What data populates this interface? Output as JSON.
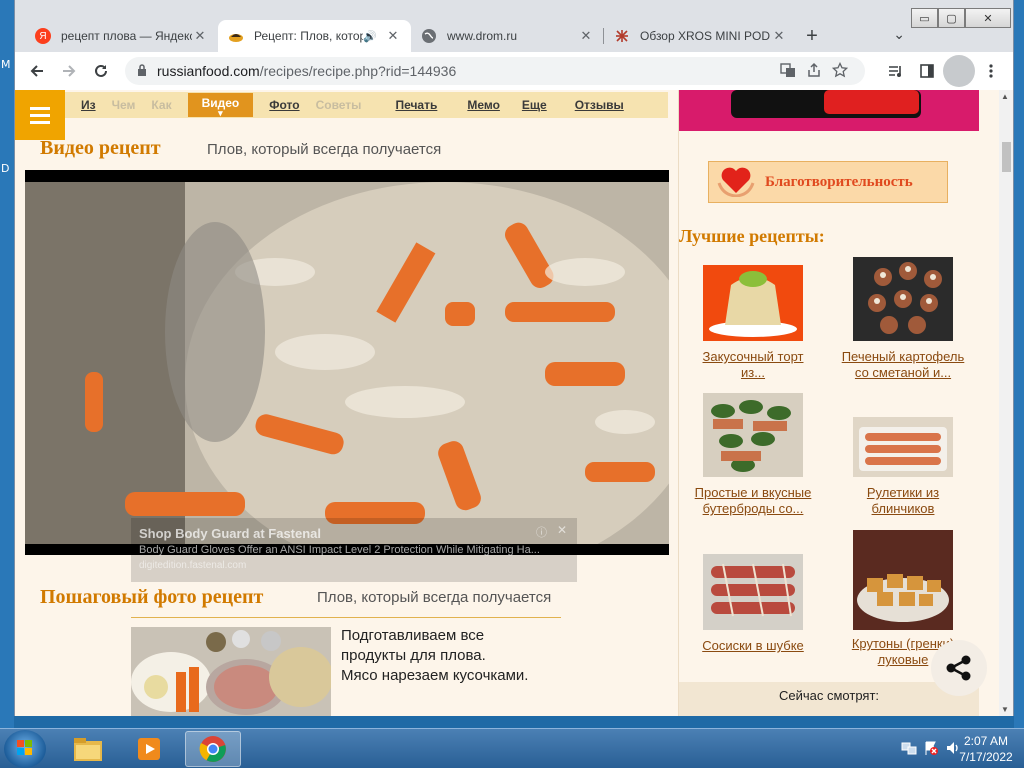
{
  "desktop": {
    "left_glyphs": [
      "M",
      "D"
    ]
  },
  "window_controls": {
    "minimize": "▭",
    "maximize": "▢",
    "close": "✕"
  },
  "tabs": [
    {
      "title": "рецепт плова — Яндекс",
      "favicon": "yandex-icon",
      "favicon_color": "#fc3f1d",
      "favicon_glyph": "Я",
      "close": "✕"
    },
    {
      "title": "Рецепт: Плов, который всегда",
      "favicon": "russianfood-icon",
      "audio": "🔊",
      "close": "✕"
    },
    {
      "title": "www.drom.ru",
      "favicon": "globe-icon",
      "close": "✕"
    },
    {
      "title": "Обзор XROS MINI POD",
      "favicon": "xros-icon",
      "close": "✕"
    }
  ],
  "new_tab": "+",
  "tab_menu": "⌄",
  "address": {
    "host": "russianfood.com",
    "path": "/recipes/recipe.php?rid=144936"
  },
  "nav": {
    "items": [
      {
        "label": "Из",
        "state": "link"
      },
      {
        "label": "Чем",
        "state": "faded"
      },
      {
        "label": "Как",
        "state": "faded"
      },
      {
        "label": "Видео",
        "state": "active"
      },
      {
        "label": "Фото",
        "state": "link"
      },
      {
        "label": "Советы",
        "state": "faded"
      },
      {
        "label": "Печать",
        "state": "link"
      },
      {
        "label": "Мемо",
        "state": "link"
      },
      {
        "label": "Еще",
        "state": "link"
      },
      {
        "label": "Отзывы",
        "state": "link"
      }
    ]
  },
  "video_section": {
    "title": "Видео рецепт",
    "subtitle": "Плов, который всегда получается"
  },
  "ad": {
    "headline": "Shop Body Guard at Fastenal",
    "text": "Body Guard Gloves Offer an ANSI Impact Level 2 Protection While Mitigating Ha...",
    "url": "digitedition.fastenal.com",
    "info": "ⓘ",
    "close": "✕"
  },
  "photo_section": {
    "title": "Пошаговый фото рецепт",
    "subtitle": "Плов, который всегда получается",
    "step1_lines": [
      "Подготавливаем все",
      "продукты для плова.",
      "Мясо нарезаем кусочками."
    ]
  },
  "sidebar": {
    "charity_label": "Благотворительность",
    "best_title": "Лучшие рецепты:",
    "recipes": [
      {
        "line1": "Закусочный торт",
        "line2": "из..."
      },
      {
        "line1": "Печеный картофель",
        "line2": "со сметаной и..."
      },
      {
        "line1": "Простые и вкусные",
        "line2": "бутерброды со..."
      },
      {
        "line1": "Рулетики из",
        "line2": "блинчиков"
      },
      {
        "line1": "Сосиски в шубке",
        "line2": ""
      },
      {
        "line1": "Крутоны (гренки)",
        "line2": "луковые"
      }
    ],
    "watching_label": "Сейчас смотрят:"
  },
  "taskbar": {
    "time": "2:07 AM",
    "date": "7/17/2022"
  }
}
